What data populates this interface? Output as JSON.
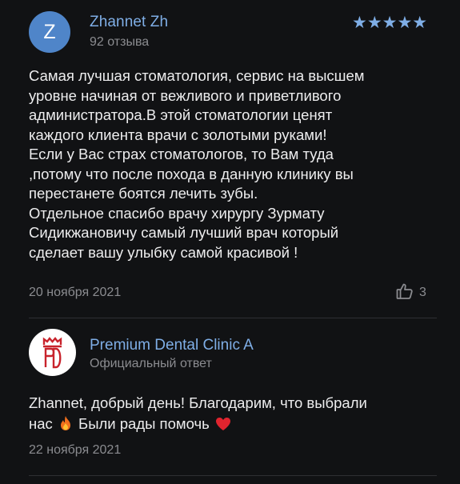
{
  "review": {
    "avatar_letter": "Z",
    "author": "Zhannet Zh",
    "author_meta": "92 отзыва",
    "rating": 5,
    "stars": "★★★★★",
    "text_lines": [
      "Самая лучшая стоматология, сервис на высшем",
      "уровне начиная от вежливого и приветливого",
      "администратора.В этой стоматологии ценят",
      "каждого клиента врачи с золотыми руками!",
      "Если у Вас страх стоматологов, то Вам туда",
      ",потому что после похода в данную клинику вы",
      "перестанете боятся лечить зубы.",
      "Отдельное спасибо врачу хирургу Зурмату",
      "Сидикжановичу самый лучший врач который",
      "сделает вашу улыбку самой красивой !"
    ],
    "date": "20 ноября 2021",
    "likes": "3"
  },
  "reply": {
    "clinic_name": "Premium Dental Clinic A",
    "meta": "Официальный ответ",
    "line1": "Zhannet, добрый день! Благодарим, что выбрали",
    "line2_start": "нас",
    "line2_end": "Были рады помочь",
    "date": "22 ноября 2021"
  },
  "colors": {
    "background": "#111214",
    "accent_blue": "#7faee6",
    "avatar_blue": "#4f85c9",
    "muted_text": "#8b8c90",
    "logo_red": "#c8232c"
  },
  "icons": {
    "like": "thumbs-up-icon",
    "fire": "fire-emoji-icon",
    "heart": "red-heart-emoji-icon"
  }
}
